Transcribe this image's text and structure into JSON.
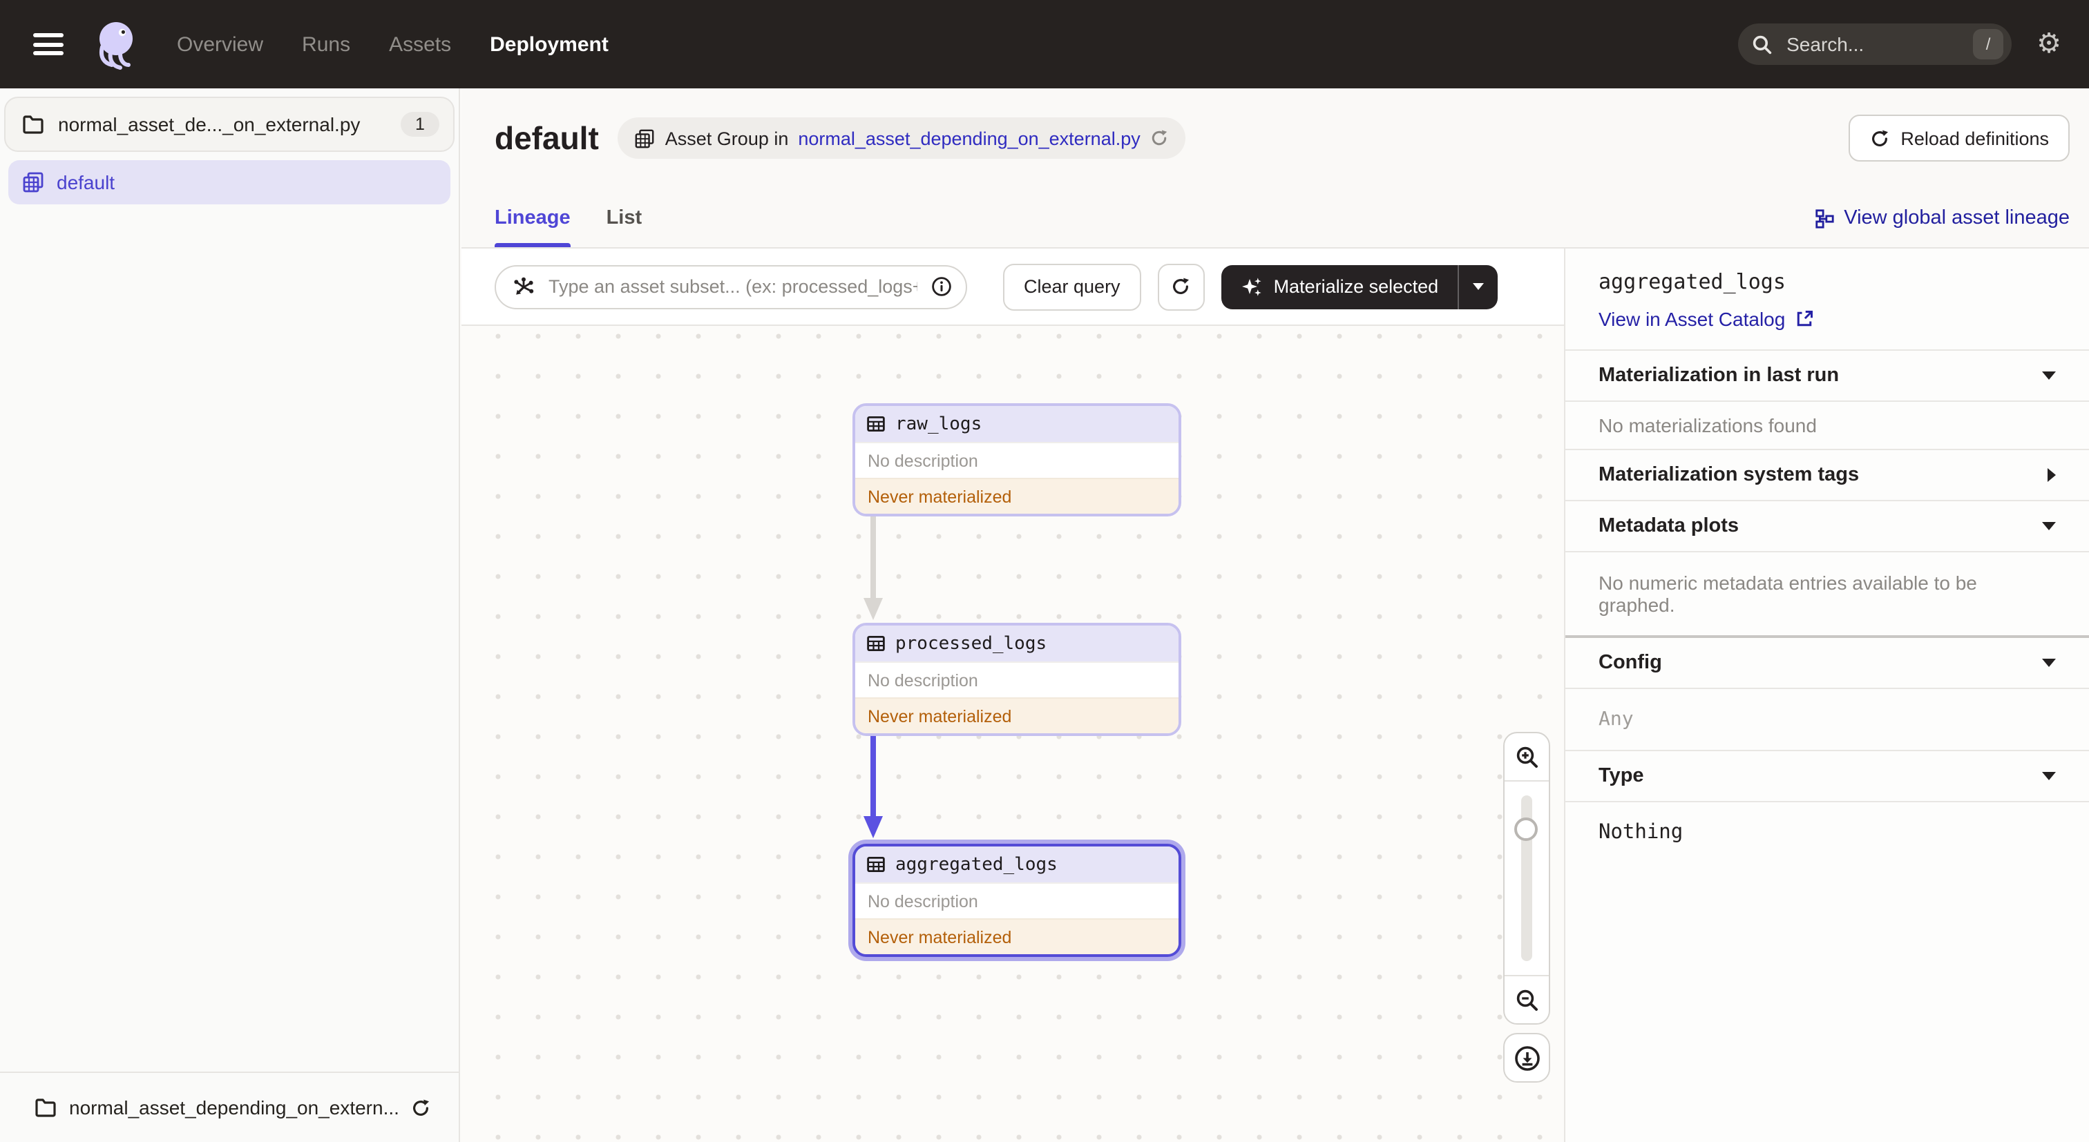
{
  "navbar": {
    "items": [
      {
        "label": "Overview",
        "active": false
      },
      {
        "label": "Runs",
        "active": false
      },
      {
        "label": "Assets",
        "active": false
      },
      {
        "label": "Deployment",
        "active": true
      }
    ],
    "search": {
      "placeholder": "Search...",
      "shortcut": "/"
    }
  },
  "sidebar": {
    "group_file": {
      "label": "normal_asset_de..._on_external.py",
      "badge": "1"
    },
    "selected_item": {
      "label": "default"
    },
    "footer": {
      "label": "normal_asset_depending_on_extern..."
    }
  },
  "header": {
    "title": "default",
    "breadcrumb": {
      "prefix": "Asset Group in",
      "link": "normal_asset_depending_on_external.py"
    },
    "reload_button": "Reload definitions"
  },
  "tabs": {
    "lineage": "Lineage",
    "list": "List",
    "global_lineage_link": "View global asset lineage"
  },
  "toolbar": {
    "query_placeholder": "Type an asset subset... (ex: processed_logs+*)",
    "clear_button": "Clear query",
    "materialize_button": "Materialize selected"
  },
  "graph": {
    "nodes": [
      {
        "name": "raw_logs",
        "description": "No description",
        "status": "Never materialized",
        "selected": false
      },
      {
        "name": "processed_logs",
        "description": "No description",
        "status": "Never materialized",
        "selected": false
      },
      {
        "name": "aggregated_logs",
        "description": "No description",
        "status": "Never materialized",
        "selected": true
      }
    ],
    "edges": [
      {
        "from": "raw_logs",
        "to": "processed_logs",
        "highlighted": false
      },
      {
        "from": "processed_logs",
        "to": "aggregated_logs",
        "highlighted": true
      }
    ]
  },
  "panel": {
    "title": "aggregated_logs",
    "catalog_link": "View in Asset Catalog",
    "sections": [
      {
        "label": "Materialization in last run",
        "caret": "down",
        "body": "No materializations found"
      },
      {
        "label": "Materialization system tags",
        "caret": "right",
        "body": ""
      },
      {
        "label": "Metadata plots",
        "caret": "down",
        "body": "No numeric metadata entries available to be graphed."
      },
      {
        "label": "Config",
        "caret": "down",
        "body": "Any"
      },
      {
        "label": "Type",
        "caret": "down",
        "body": "Nothing"
      }
    ]
  },
  "colors": {
    "navbar_bg": "#262220",
    "accent_indigo": "#4F46D6",
    "link_blue": "#2F2BC0",
    "dark_link_blue": "#2521A6",
    "node_border": "#C6C1EF",
    "node_selected_border": "#544CD6",
    "node_header_bg": "#E6E4F7",
    "status_text": "#B35F09",
    "status_bg": "#FAF1E4",
    "sidebar_selected_bg": "#E4E2F6",
    "edge_gray": "#D9D6D2",
    "edge_highlight": "#5B51E1"
  }
}
